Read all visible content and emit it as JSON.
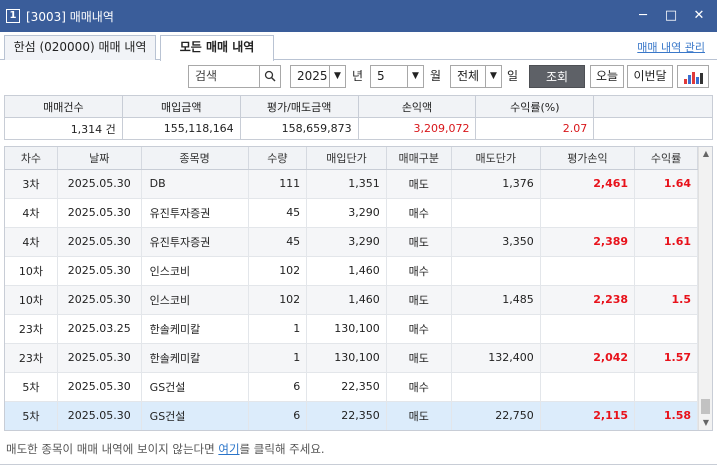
{
  "window": {
    "number": "1",
    "title": "[3003] 매매내역",
    "minimize": "─",
    "maximize": "□",
    "close": "✕"
  },
  "tabs": [
    {
      "label": "한섬 (020000) 매매 내역"
    },
    {
      "label": "모든 매매 내역"
    }
  ],
  "manage_link": "매매 내역 관리",
  "toolbar": {
    "search_placeholder": "검색",
    "year": "2025",
    "year_label": "년",
    "month": "5",
    "month_label": "월",
    "type": "전체",
    "day_label": "일",
    "query_button": "조회",
    "today_button": "오늘",
    "this_month_button": "이번달"
  },
  "summary": {
    "headers": [
      "매매건수",
      "매입금액",
      "평가/매도금액",
      "손익액",
      "수익률(%)",
      ""
    ],
    "values": [
      "1,314 건",
      "155,118,164",
      "158,659,873",
      "3,209,072",
      "2.07",
      ""
    ]
  },
  "list": {
    "headers": [
      "차수",
      "날짜",
      "종목명",
      "수량",
      "매입단가",
      "매매구분",
      "매도단가",
      "평가손익",
      "수익률"
    ],
    "rows": [
      [
        "3차",
        "2025.05.30",
        "DB",
        "111",
        "1,351",
        "매도",
        "1,376",
        "2,461",
        "1.64"
      ],
      [
        "4차",
        "2025.05.30",
        "유진투자증권",
        "45",
        "3,290",
        "매수",
        "",
        "",
        ""
      ],
      [
        "4차",
        "2025.05.30",
        "유진투자증권",
        "45",
        "3,290",
        "매도",
        "3,350",
        "2,389",
        "1.61"
      ],
      [
        "10차",
        "2025.05.30",
        "인스코비",
        "102",
        "1,460",
        "매수",
        "",
        "",
        ""
      ],
      [
        "10차",
        "2025.05.30",
        "인스코비",
        "102",
        "1,460",
        "매도",
        "1,485",
        "2,238",
        "1.5"
      ],
      [
        "23차",
        "2025.03.25",
        "한솔케미칼",
        "1",
        "130,100",
        "매수",
        "",
        "",
        ""
      ],
      [
        "23차",
        "2025.05.30",
        "한솔케미칼",
        "1",
        "130,100",
        "매도",
        "132,400",
        "2,042",
        "1.57"
      ],
      [
        "5차",
        "2025.05.30",
        "GS건설",
        "6",
        "22,350",
        "매수",
        "",
        "",
        ""
      ],
      [
        "5차",
        "2025.05.30",
        "GS건설",
        "6",
        "22,350",
        "매도",
        "22,750",
        "2,115",
        "1.58"
      ]
    ]
  },
  "footer": {
    "before": "매도한 종목이 매매 내역에 보이지 않는다면 ",
    "link": "여기",
    "after": "를 클릭해 주세요."
  },
  "colors": {
    "title_bar": "#3a5d9a",
    "profit_red": "#e8121b",
    "selected_row": "#dcecfb",
    "query_button": "#5e6167"
  }
}
